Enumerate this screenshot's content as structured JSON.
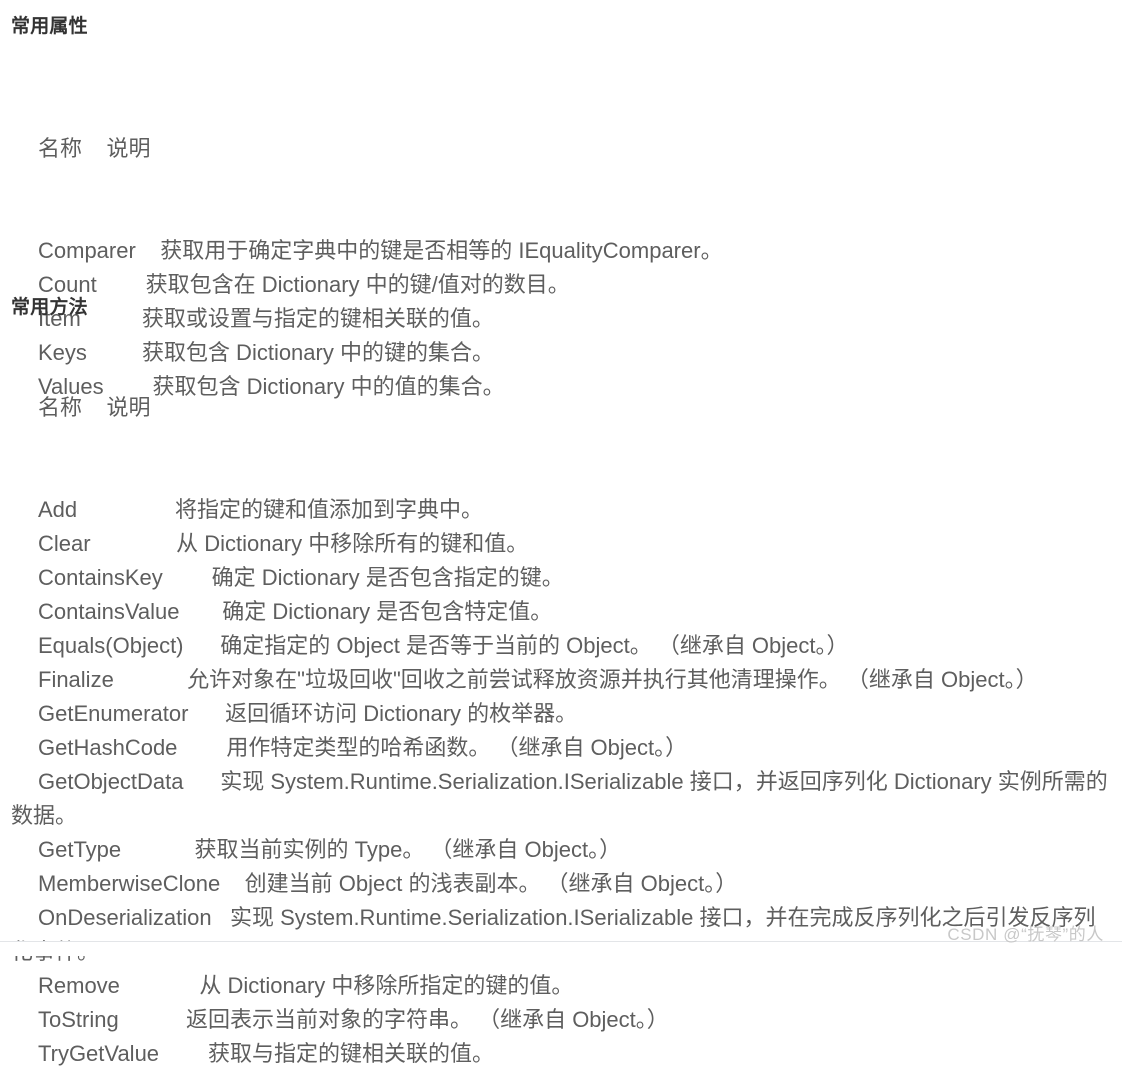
{
  "document": {
    "watermark": "CSDN @“抚琴”的人"
  },
  "sections": [
    {
      "id": "common-properties",
      "heading": "常用属性",
      "columns": {
        "name": "名称",
        "description": "说明"
      },
      "column_header_line": "名称    说明",
      "rows": [
        {
          "name": "Comparer",
          "gap": "    ",
          "desc": "获取用于确定字典中的键是否相等的 IEqualityComparer。"
        },
        {
          "name": "Count",
          "gap": "        ",
          "desc": "获取包含在 Dictionary 中的键/值对的数目。"
        },
        {
          "name": "Item",
          "gap": "          ",
          "desc": "获取或设置与指定的键相关联的值。"
        },
        {
          "name": "Keys",
          "gap": "         ",
          "desc": "获取包含 Dictionary 中的键的集合。"
        },
        {
          "name": "Values",
          "gap": "        ",
          "desc": "获取包含 Dictionary 中的值的集合。"
        }
      ]
    },
    {
      "id": "common-methods",
      "heading": "常用方法",
      "columns": {
        "name": "名称",
        "description": "说明"
      },
      "column_header_line": "名称    说明",
      "rows": [
        {
          "name": "Add",
          "gap": "                ",
          "desc": "将指定的键和值添加到字典中。"
        },
        {
          "name": "Clear",
          "gap": "              ",
          "desc": "从 Dictionary 中移除所有的键和值。"
        },
        {
          "name": "ContainsKey",
          "gap": "        ",
          "desc": "确定 Dictionary 是否包含指定的键。"
        },
        {
          "name": "ContainsValue",
          "gap": "       ",
          "desc": "确定 Dictionary 是否包含特定值。"
        },
        {
          "name": "Equals(Object)",
          "gap": "      ",
          "desc": "确定指定的 Object 是否等于当前的 Object。 （继承自 Object。）"
        },
        {
          "name": "Finalize",
          "gap": "            ",
          "desc": "允许对象在\"垃圾回收\"回收之前尝试释放资源并执行其他清理操作。 （继承自 Object。）"
        },
        {
          "name": "GetEnumerator",
          "gap": "      ",
          "desc": "返回循环访问 Dictionary 的枚举器。"
        },
        {
          "name": "GetHashCode",
          "gap": "        ",
          "desc": "用作特定类型的哈希函数。 （继承自 Object。）"
        },
        {
          "name": "GetObjectData",
          "gap": "      ",
          "desc": "实现 System.Runtime.Serialization.ISerializable 接口，并返回序列化 Dictionary 实例所需的数据。"
        },
        {
          "name": "GetType",
          "gap": "            ",
          "desc": "获取当前实例的 Type。 （继承自 Object。）"
        },
        {
          "name": "MemberwiseClone",
          "gap": "    ",
          "desc": "创建当前 Object 的浅表副本。 （继承自 Object。）"
        },
        {
          "name": "OnDeserialization",
          "gap": "   ",
          "desc": "实现 System.Runtime.Serialization.ISerializable 接口，并在完成反序列化之后引发反序列化事件。"
        },
        {
          "name": "Remove",
          "gap": "             ",
          "desc": "从 Dictionary 中移除所指定的键的值。"
        },
        {
          "name": "ToString",
          "gap": "           ",
          "desc": "返回表示当前对象的字符串。 （继承自 Object。）"
        },
        {
          "name": "TryGetValue",
          "gap": "        ",
          "desc": "获取与指定的键相关联的值。"
        }
      ]
    }
  ],
  "colors": {
    "body_text": "#5e5e5e",
    "heading_text": "#333333",
    "watermark_text": "#c8c8c8",
    "divider": "#e3e5e8",
    "background": "#ffffff"
  }
}
